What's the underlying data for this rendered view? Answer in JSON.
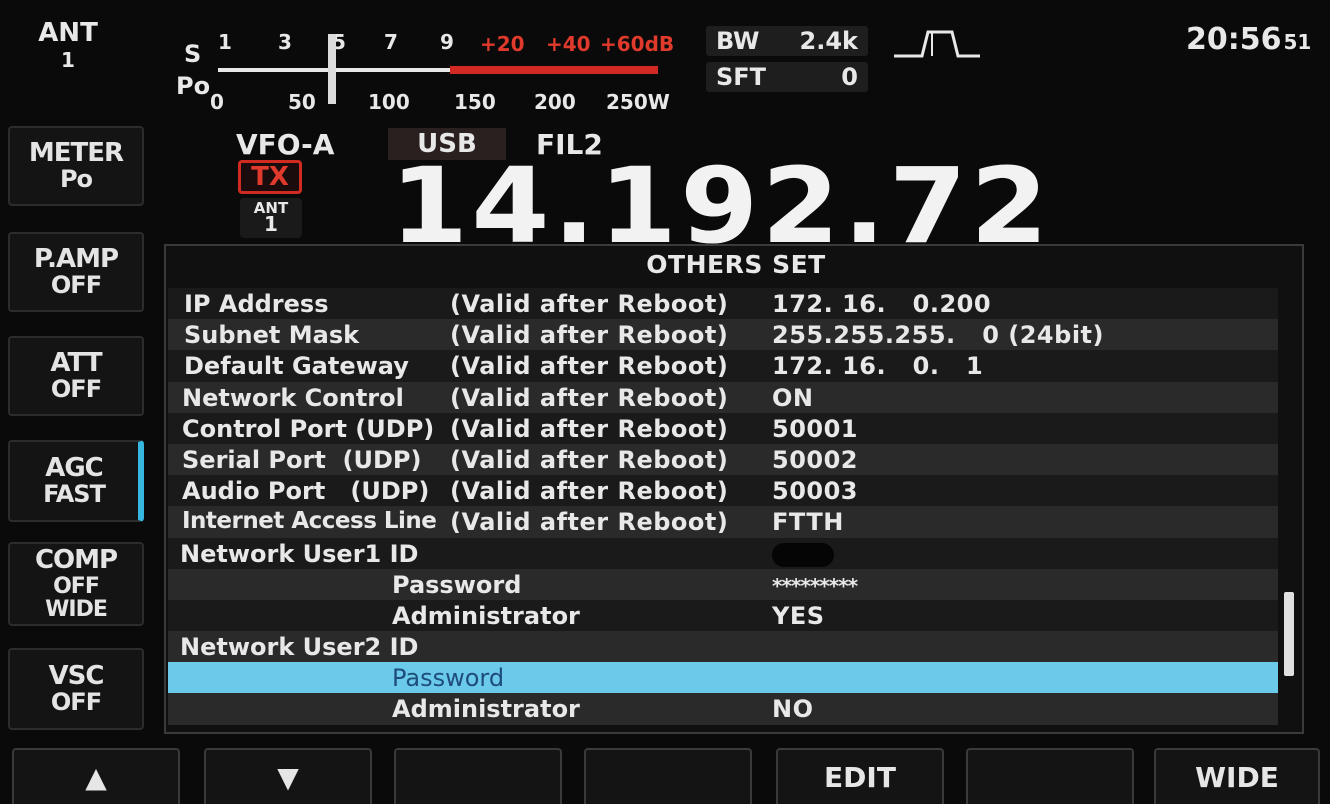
{
  "left_keys": {
    "ant": {
      "label": "ANT",
      "value": "1"
    },
    "meter": {
      "label": "METER",
      "value": "Po"
    },
    "pamp": {
      "label": "P.AMP",
      "value": "OFF"
    },
    "att": {
      "label": "ATT",
      "value": "OFF"
    },
    "agc": {
      "label": "AGC",
      "value": "FAST"
    },
    "comp": {
      "label": "COMP",
      "value": "OFF",
      "value2": "WIDE"
    },
    "vsc": {
      "label": "VSC",
      "value": "OFF"
    }
  },
  "meter": {
    "s_label": "S",
    "po_label": "Po",
    "s_scale": [
      "1",
      "3",
      "5",
      "7",
      "9",
      "+20",
      "+40",
      "+60dB"
    ],
    "po_scale": [
      "0",
      "50",
      "100",
      "150",
      "200",
      "250W"
    ]
  },
  "filter": {
    "bw_label": "BW",
    "bw_value": "2.4k",
    "sft_label": "SFT",
    "sft_value": "0"
  },
  "clock": {
    "time": "20:56",
    "seconds": "51"
  },
  "vfo": {
    "name": "VFO-A",
    "mode": "USB",
    "filter": "FIL2",
    "tx": "TX",
    "ant_label": "ANT",
    "ant_value": "1",
    "frequency": "14.192.72"
  },
  "panel": {
    "title": "OTHERS SET",
    "rows": [
      {
        "name": "IP Address",
        "note": "(Valid after Reboot)",
        "value": "172. 16.   0.200"
      },
      {
        "name": "Subnet Mask",
        "note": "(Valid after Reboot)",
        "value": "255.255.255.   0 (24bit)"
      },
      {
        "name": "Default Gateway",
        "note": "(Valid after Reboot)",
        "value": "172. 16.   0.   1"
      },
      {
        "name": "Network Control",
        "note": "(Valid after Reboot)",
        "value": "ON"
      },
      {
        "name": "Control Port (UDP)",
        "note": "(Valid after Reboot)",
        "value": "50001"
      },
      {
        "name": "Serial Port  (UDP)",
        "note": "(Valid after Reboot)",
        "value": "50002"
      },
      {
        "name": "Audio Port   (UDP)",
        "note": "(Valid after Reboot)",
        "value": "50003"
      },
      {
        "name": "Internet Access Line",
        "note": "(Valid after Reboot)",
        "value": "FTTH"
      },
      {
        "name": "Network User1 ID",
        "note": "",
        "value": ""
      },
      {
        "name": "Password",
        "note": "",
        "value": "*********"
      },
      {
        "name": "Administrator",
        "note": "",
        "value": "YES"
      },
      {
        "name": "Network User2 ID",
        "note": "",
        "value": ""
      },
      {
        "name": "Password",
        "note": "",
        "value": ""
      },
      {
        "name": "Administrator",
        "note": "",
        "value": "NO"
      }
    ]
  },
  "bottom_keys": [
    "▲",
    "▼",
    "",
    "",
    "EDIT",
    "",
    "WIDE"
  ]
}
